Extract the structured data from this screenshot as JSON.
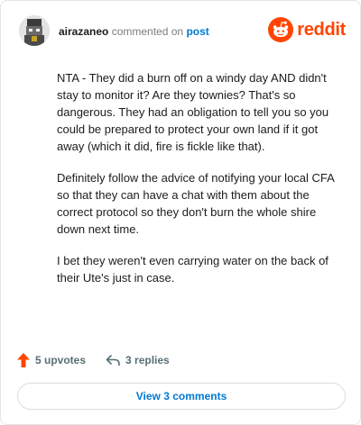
{
  "comment": {
    "username": "airazaneo",
    "action_text": "commented on",
    "target_link": "post",
    "paragraphs": [
      "NTA - They did a burn off on a windy day AND didn't stay to monitor it? Are they townies? That's so dangerous. They had an obligation to tell you so you could be prepared to protect your own land if it got away (which it did, fire is fickle like that).",
      "Definitely follow the advice of notifying your local CFA so that they can have a chat with them about the correct protocol so they don't burn the whole shire down next time.",
      "I bet they weren't even carrying water on the back of their Ute's just in case."
    ]
  },
  "brand": {
    "wordmark": "reddit",
    "icon": "reddit-logo-icon",
    "color": "#ff4500"
  },
  "actions": {
    "upvotes_label": "5 upvotes",
    "upvote_icon": "upvote-arrow-icon",
    "upvote_color": "#ff4500",
    "replies_label": "3 replies",
    "reply_icon": "reply-arrow-icon"
  },
  "view_button": {
    "label": "View 3 comments",
    "color": "#0079d3"
  }
}
